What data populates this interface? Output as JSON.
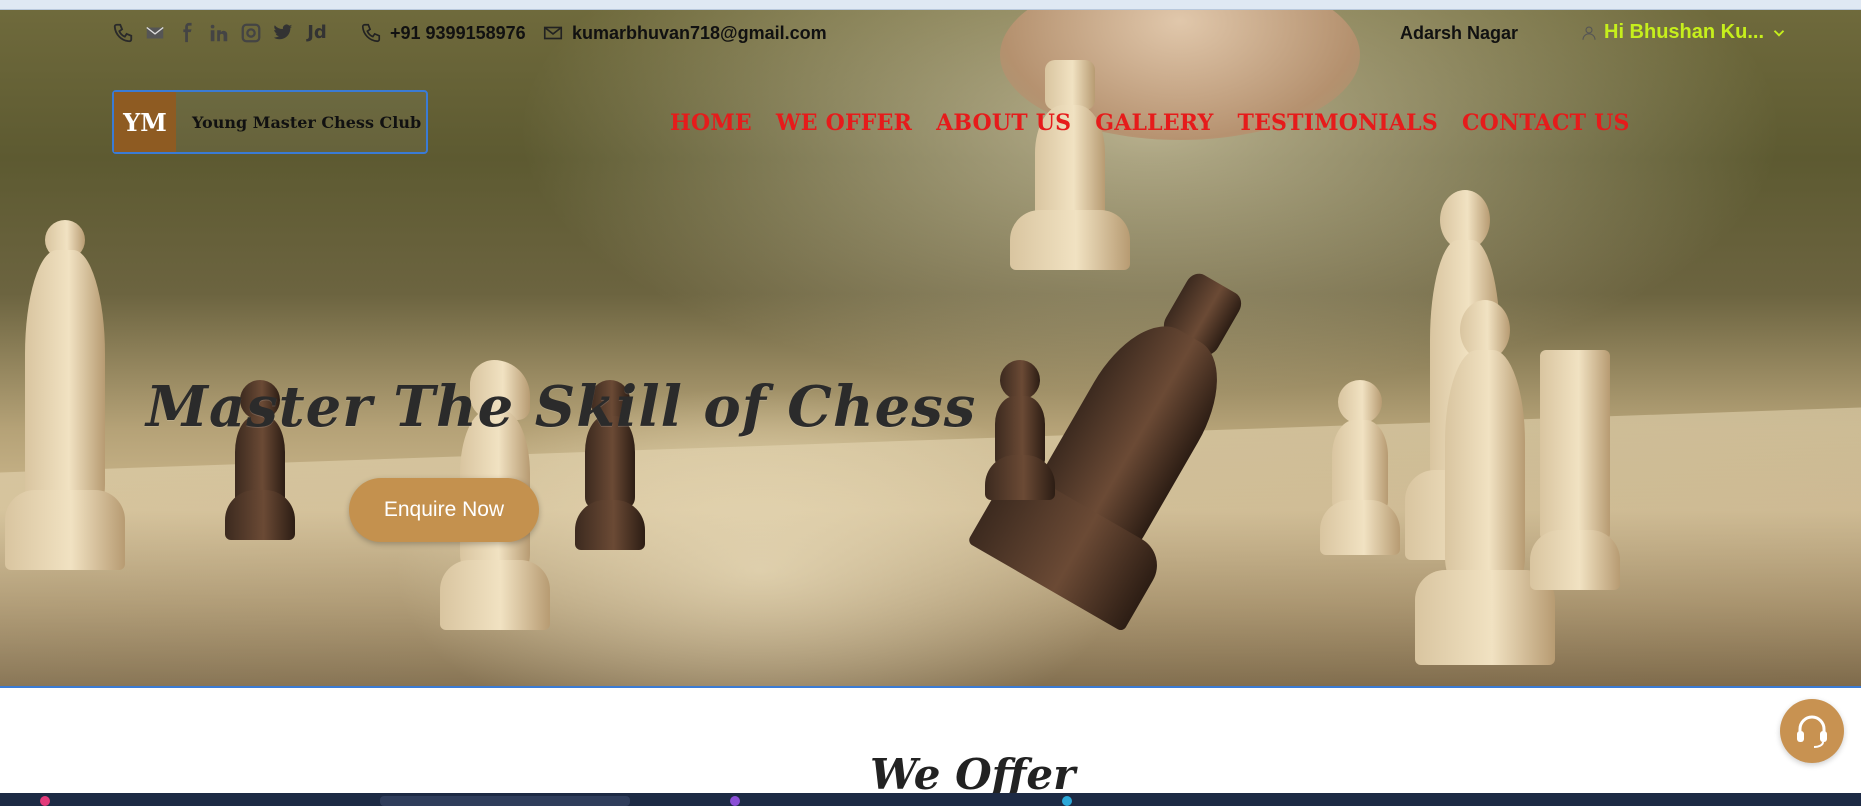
{
  "topbar": {
    "social_icons": [
      "phone-icon",
      "mail-icon",
      "facebook-icon",
      "linkedin-icon",
      "instagram-icon",
      "twitter-icon",
      "justdial-icon"
    ],
    "justdial_label": "Jd",
    "phone": "+91 9399158976",
    "email": "kumarbhuvan718@gmail.com",
    "location": "Adarsh Nagar",
    "user_greeting": "Hi Bhushan Ku..."
  },
  "logo": {
    "initials": "YM",
    "name": "Young Master Chess Club"
  },
  "nav": {
    "items": [
      "HOME",
      "WE OFFER",
      "ABOUT US",
      "GALLERY",
      "TESTIMONIALS",
      "CONTACT US"
    ]
  },
  "hero": {
    "headline": "Master The Skill of Chess",
    "cta_label": "Enquire Now"
  },
  "section": {
    "title": "We Offer"
  },
  "colors": {
    "nav_text": "#e61b1b",
    "user_text": "#c6ef1c",
    "cta_bg": "#c4914e",
    "logo_badge": "#8e5b22",
    "border_accent": "#3a7bd5"
  }
}
